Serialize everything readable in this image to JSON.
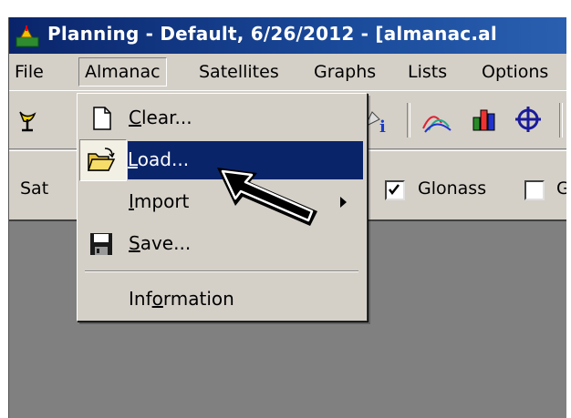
{
  "window": {
    "title": "Planning - Default, 6/26/2012 - [almanac.al",
    "app_icon": "planning-app-icon"
  },
  "menubar": {
    "items": [
      {
        "label": "File"
      },
      {
        "label": "Almanac"
      },
      {
        "label": "Satellites"
      },
      {
        "label": "Graphs"
      },
      {
        "label": "Lists"
      },
      {
        "label": "Options"
      }
    ]
  },
  "toolbar": {
    "icons": [
      "satellite-dish-icon",
      "info-icon",
      "elevation-graph-icon",
      "bar-chart-icon",
      "crosshair-icon"
    ]
  },
  "filterbar": {
    "satellites_label": "Sat",
    "glonass_label": "Glonass",
    "glonass_checked": true,
    "g_label": "G",
    "g_checked": false
  },
  "almanac_menu": {
    "items": [
      {
        "label": "Clear...",
        "mnemonic": "C",
        "icon": "blank-document-icon"
      },
      {
        "label": "Load...",
        "mnemonic": "L",
        "icon": "open-folder-icon",
        "highlighted": true
      },
      {
        "label": "Import",
        "mnemonic": "I",
        "has_submenu": true
      },
      {
        "label": "Save...",
        "mnemonic": "S",
        "icon": "floppy-disk-icon"
      },
      {
        "label": "Information",
        "mnemonic": "o"
      }
    ]
  },
  "annotation": {
    "icon": "pointer-arrow-icon"
  },
  "colors": {
    "title_bar": "#0a246a",
    "menu_highlight": "#0a246a",
    "face": "#d4d0c8",
    "client_area": "#808080"
  }
}
